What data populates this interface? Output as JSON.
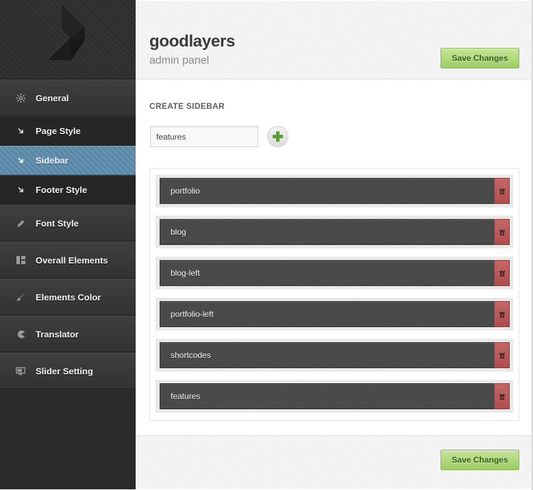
{
  "brand": {
    "title": "goodlayers",
    "subtitle": "admin panel",
    "logo_icon": "goodlayers-logo-icon"
  },
  "header": {
    "save_label": "Save Changes"
  },
  "footer": {
    "save_label": "Save Changes"
  },
  "sidebar": {
    "items": [
      {
        "label": "General",
        "icon": "gear-icon",
        "type": "main"
      },
      {
        "label": "Page Style",
        "icon": "arrow-down-right-icon",
        "type": "sub"
      },
      {
        "label": "Sidebar",
        "icon": "arrow-down-right-icon",
        "type": "sub",
        "active": true
      },
      {
        "label": "Footer Style",
        "icon": "arrow-down-right-icon",
        "type": "sub"
      },
      {
        "label": "Font Style",
        "icon": "pencil-icon",
        "type": "main"
      },
      {
        "label": "Overall Elements",
        "icon": "layout-icon",
        "type": "main"
      },
      {
        "label": "Elements Color",
        "icon": "brush-icon",
        "type": "main"
      },
      {
        "label": "Translator",
        "icon": "pacman-icon",
        "type": "main"
      },
      {
        "label": "Slider Setting",
        "icon": "monitor-icon",
        "type": "main"
      }
    ]
  },
  "create_sidebar": {
    "title": "CREATE SIDEBAR",
    "input_value": "features",
    "add_icon": "plus-icon"
  },
  "sidebars": [
    {
      "name": "portfolio"
    },
    {
      "name": "blog"
    },
    {
      "name": "blog-left"
    },
    {
      "name": "portfolio-left"
    },
    {
      "name": "shortcodes"
    },
    {
      "name": "features"
    }
  ],
  "colors": {
    "active_nav": "#5b87a4",
    "save_button": "#b2db7e",
    "delete_button": "#b85858"
  }
}
